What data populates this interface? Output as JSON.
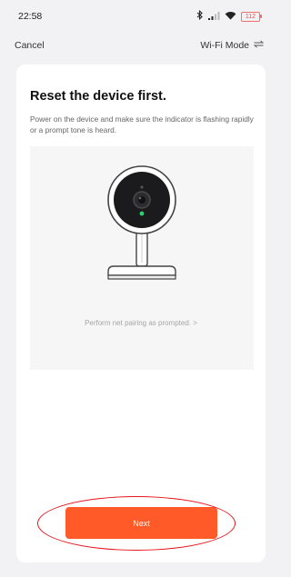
{
  "status_bar": {
    "time": "22:58",
    "battery": "112",
    "icons": [
      "bluetooth-icon",
      "signal-icon",
      "wifi-icon",
      "battery-icon"
    ]
  },
  "nav": {
    "cancel_label": "Cancel",
    "mode_label": "Wi-Fi Mode",
    "mode_icon": "swap-icon"
  },
  "content": {
    "title": "Reset the device first.",
    "description": "Power on the device and make sure the indicator is flashing rapidly or a prompt tone is heard.",
    "pairing_link": "Perform net pairing as prompted.",
    "pairing_chevron": ">",
    "illustration": "camera-illustration"
  },
  "actions": {
    "next_label": "Next"
  },
  "colors": {
    "accent": "#ff5a28",
    "highlight_oval": "#e8121b",
    "indicator_led": "#2bd46a",
    "background": "#f2f2f4"
  }
}
